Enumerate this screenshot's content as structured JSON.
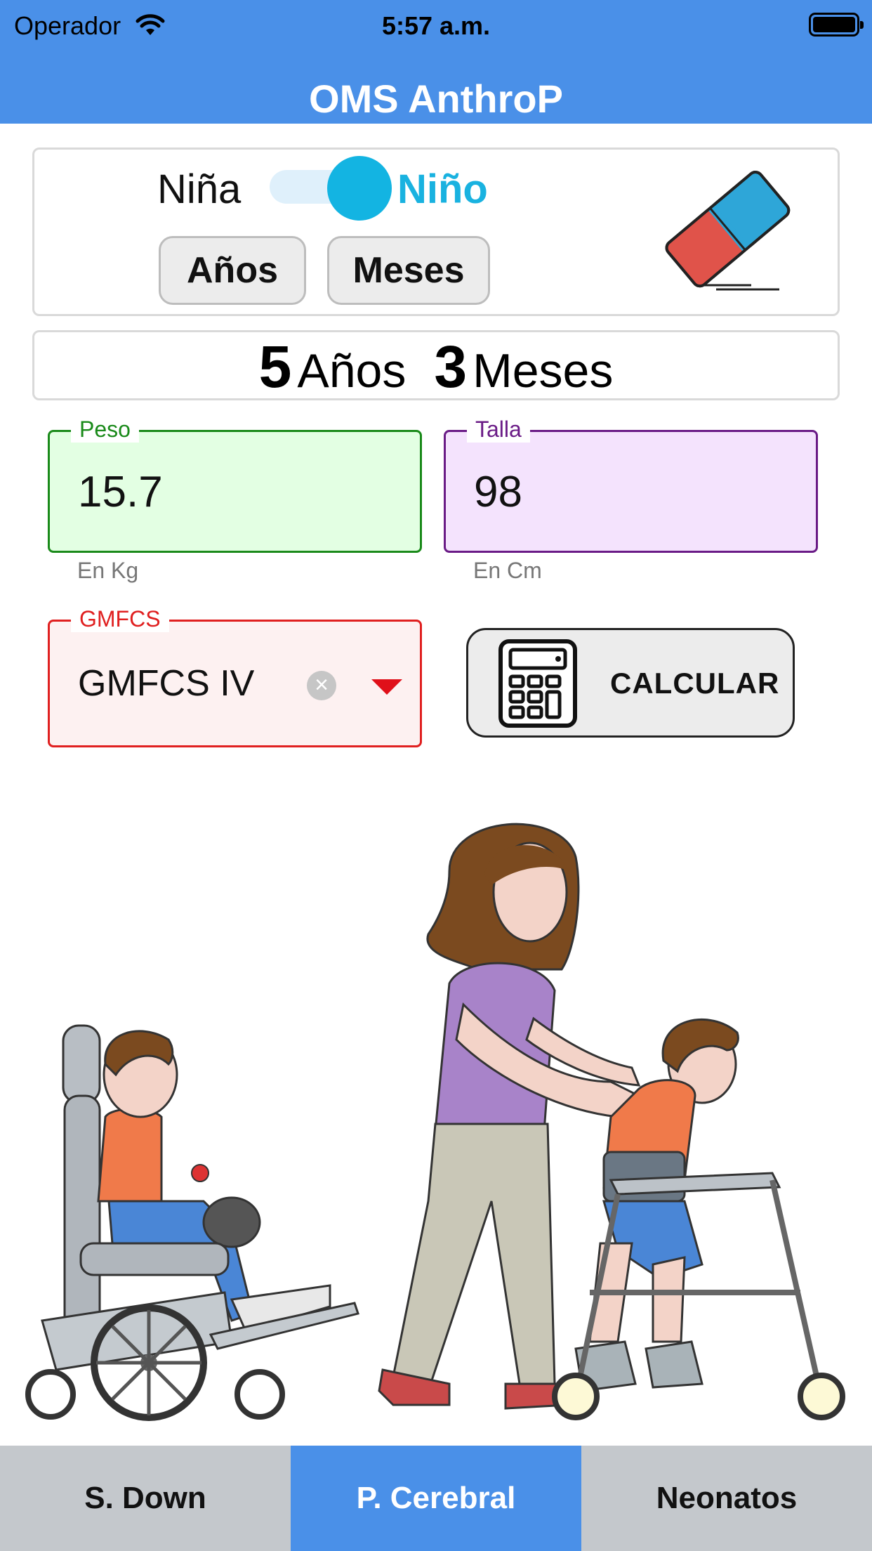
{
  "status_bar": {
    "carrier": "Operador",
    "time": "5:57 a.m."
  },
  "header": {
    "title": "OMS AnthroP"
  },
  "gender": {
    "female_label": "Niña",
    "male_label": "Niño",
    "selected": "Niño"
  },
  "age_buttons": {
    "years_label": "Años",
    "months_label": "Meses"
  },
  "age_display": {
    "years": "5",
    "years_unit": "Años",
    "months": "3",
    "months_unit": "Meses"
  },
  "peso": {
    "label": "Peso",
    "value": "15.7",
    "helper": "En Kg"
  },
  "talla": {
    "label": "Talla",
    "value": "98",
    "helper": "En Cm"
  },
  "gmfcs": {
    "label": "GMFCS",
    "value": "GMFCS IV"
  },
  "calculate": {
    "label": "CALCULAR"
  },
  "tabs": [
    {
      "label": "S. Down",
      "active": false
    },
    {
      "label": "P. Cerebral",
      "active": true
    },
    {
      "label": "Neonatos",
      "active": false
    }
  ],
  "colors": {
    "header": "#4a90e8",
    "switch_on": "#13b4e2",
    "peso": "#1a8a1a",
    "talla": "#6a1b86",
    "gmfcs": "#e02020"
  },
  "icons": [
    "wifi-icon",
    "battery-icon",
    "eraser-icon",
    "clear-icon",
    "dropdown-arrow-icon",
    "calculator-icon"
  ]
}
